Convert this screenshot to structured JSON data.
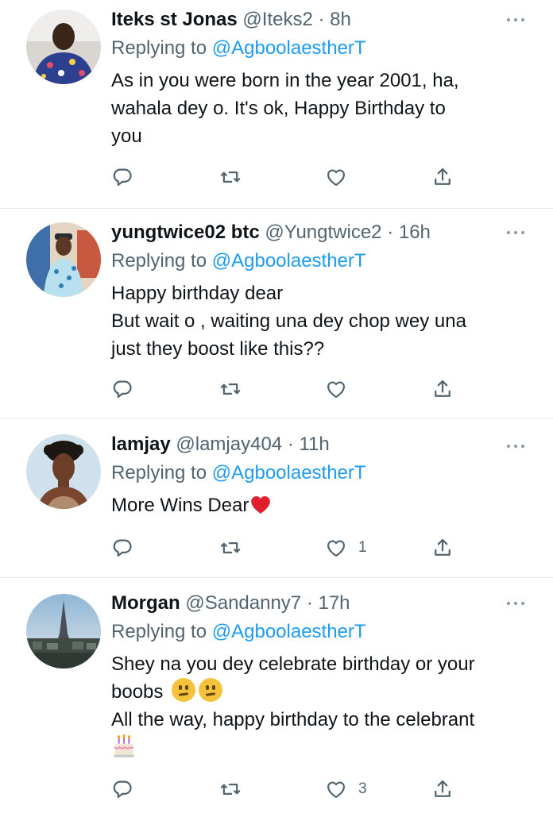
{
  "tweets": [
    {
      "name": "Iteks st Jonas",
      "handle": "@Iteks2",
      "time": "· 8h",
      "replying_prefix": "Replying to",
      "replying_to": "@AgboolaestherT",
      "lines": [
        "As in you were born in the year 2001, ha,",
        "wahala dey o. It's ok, Happy Birthday to",
        "you"
      ],
      "likes": ""
    },
    {
      "name": "yungtwice02 btc",
      "handle": "@Yungtwice2",
      "time": "· 16h",
      "replying_prefix": "Replying to",
      "replying_to": "@AgboolaestherT",
      "lines": [
        "Happy birthday dear",
        "But wait o , waiting una dey chop wey una",
        "just they boost like this??"
      ],
      "likes": ""
    },
    {
      "name": "lamjay",
      "handle": "@lamjay404",
      "time": "· 11h",
      "replying_prefix": "Replying to",
      "replying_to": "@AgboolaestherT",
      "lines": [
        "More Wins Dear"
      ],
      "likes": "1"
    },
    {
      "name": "Morgan",
      "handle": "@Sandanny7",
      "time": "· 17h",
      "replying_prefix": "Replying to",
      "replying_to": "@AgboolaestherT",
      "lines": [
        "Shey na you dey celebrate birthday or your",
        "boobs",
        "All the way, happy birthday to the celebrant"
      ],
      "likes": "3"
    }
  ],
  "icons": {
    "reply": "reply-icon",
    "retweet": "retweet-icon",
    "like": "heart-icon",
    "share": "share-icon",
    "more": "more-icon"
  },
  "colors": {
    "link": "#1d9bf0",
    "muted": "#536471",
    "text": "#0f1419",
    "divider": "#e6ecf0",
    "heart_emoji": "#e0202c"
  }
}
